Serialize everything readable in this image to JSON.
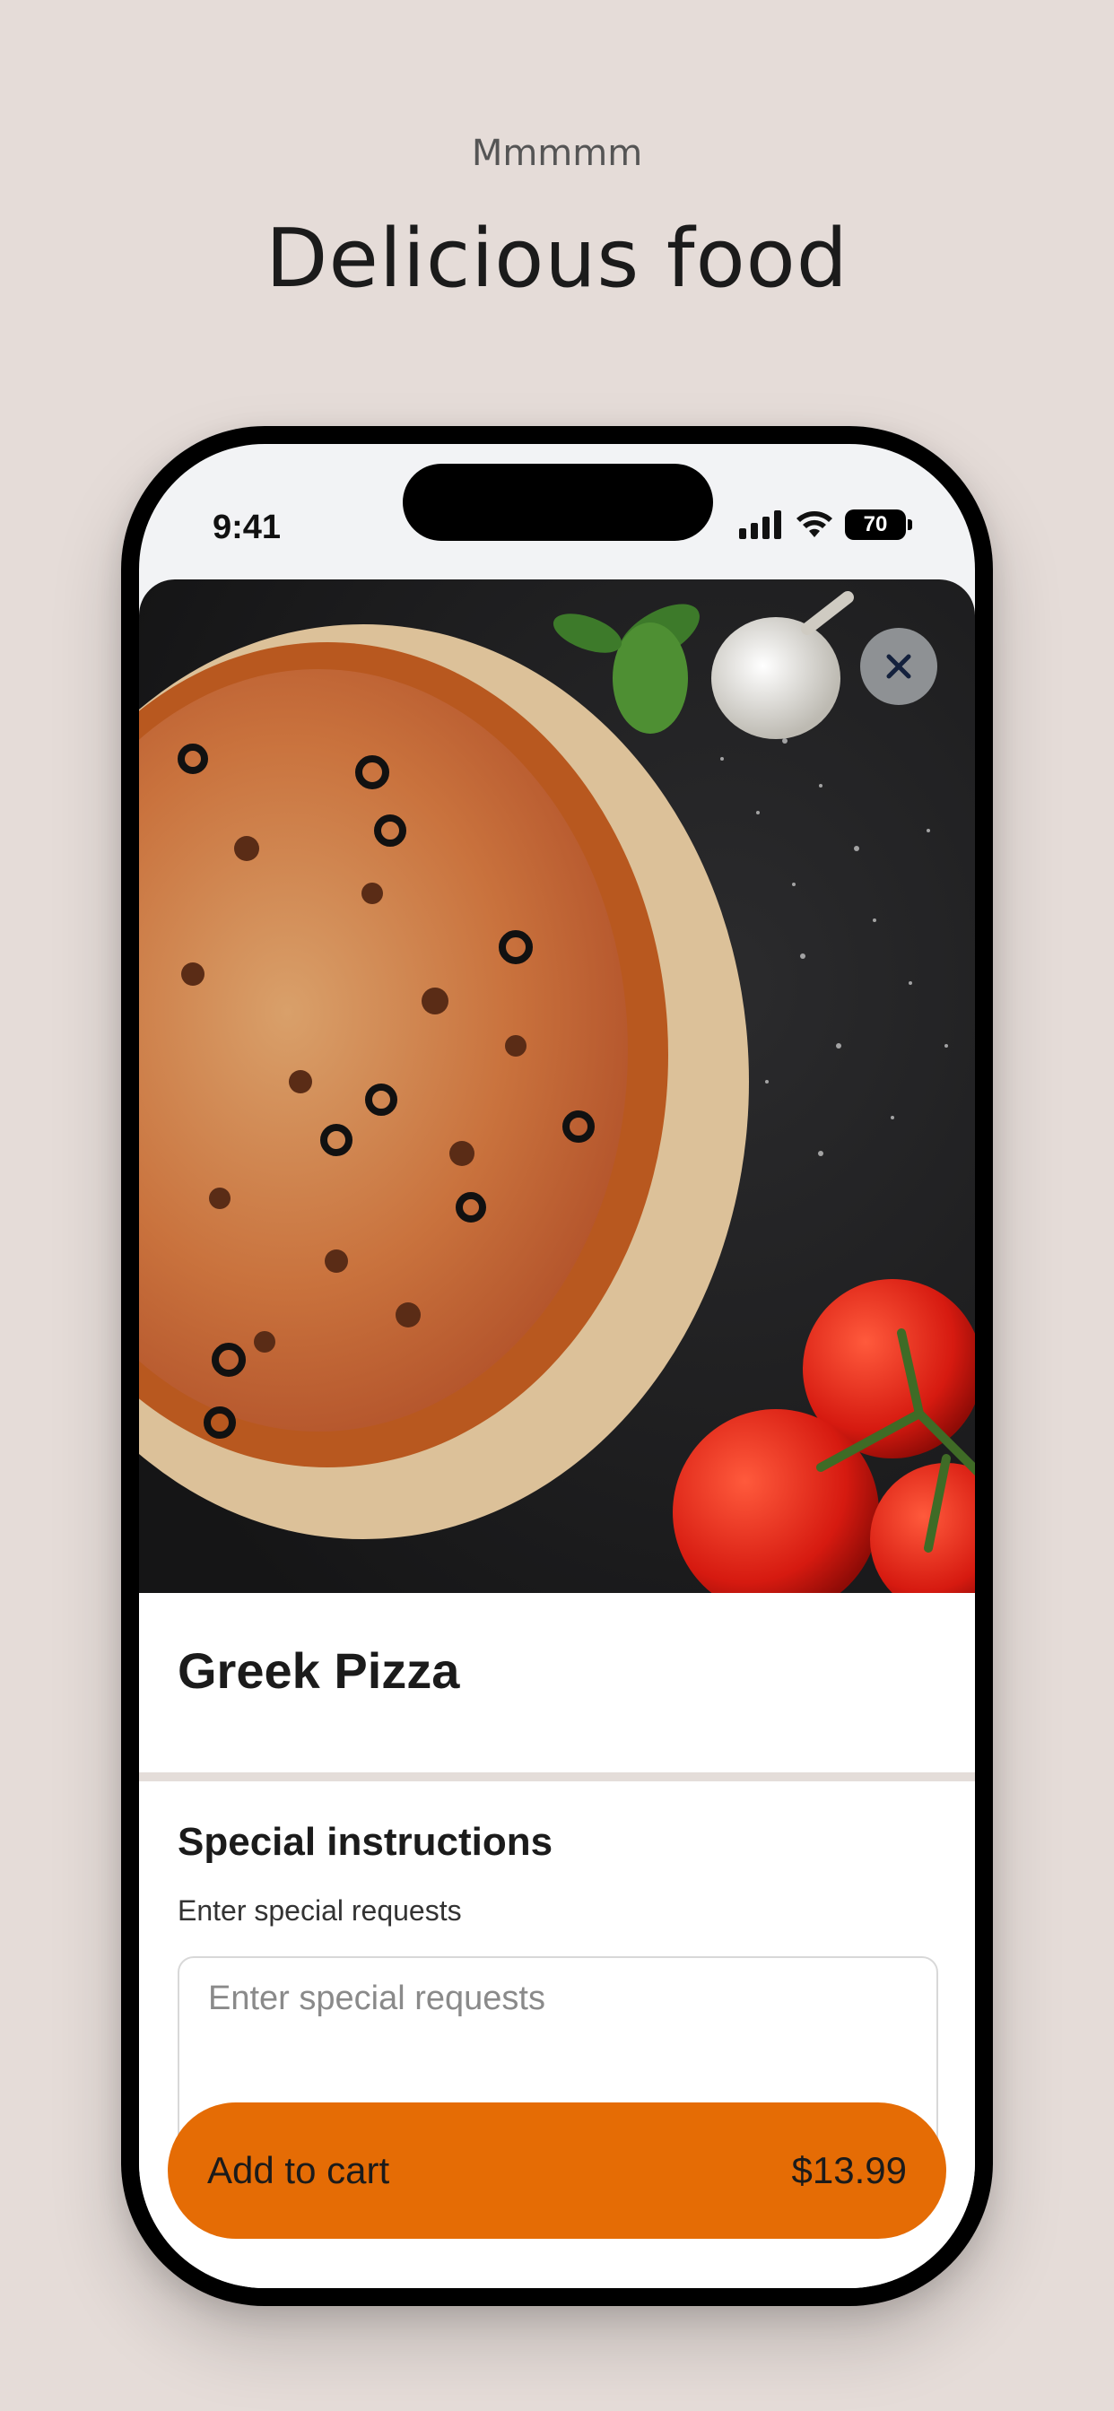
{
  "header": {
    "eyebrow": "Mmmmm",
    "headline": "Delicious food"
  },
  "status_bar": {
    "time": "9:41",
    "battery": "70"
  },
  "item": {
    "title": "Greek Pizza",
    "image_alt": "Pizza on wooden board with tomatoes, garlic and basil"
  },
  "instructions": {
    "title": "Special instructions",
    "subtitle": "Enter special requests",
    "placeholder": "Enter special requests"
  },
  "cart": {
    "label": "Add to cart",
    "price": "$13.99"
  },
  "colors": {
    "background": "#e5dcd8",
    "accent": "#e56c05",
    "close_button": "#8e9194"
  },
  "icons": {
    "close": "close-icon",
    "signal": "cellular-signal-icon",
    "wifi": "wifi-icon",
    "battery": "battery-icon"
  }
}
